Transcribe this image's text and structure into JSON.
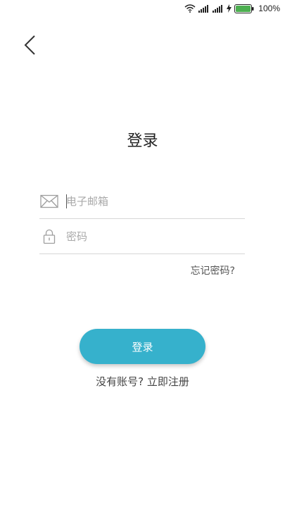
{
  "status_bar": {
    "battery_percent": "100%",
    "icons": [
      "wifi-icon",
      "signal-icon",
      "signal-icon",
      "charging-icon",
      "battery-icon"
    ],
    "battery_color": "#4caf50"
  },
  "nav": {
    "back_icon": "chevron-left-icon"
  },
  "page": {
    "title": "登录"
  },
  "form": {
    "email": {
      "icon": "envelope-icon",
      "placeholder": "电子邮箱",
      "value": ""
    },
    "password": {
      "icon": "lock-icon",
      "placeholder": "密码",
      "value": ""
    },
    "forgot_label": "忘记密码?"
  },
  "actions": {
    "login_label": "登录",
    "register_label": "没有账号? 立即注册"
  },
  "colors": {
    "accent": "#36b1cc",
    "divider": "#d6d6d6"
  }
}
